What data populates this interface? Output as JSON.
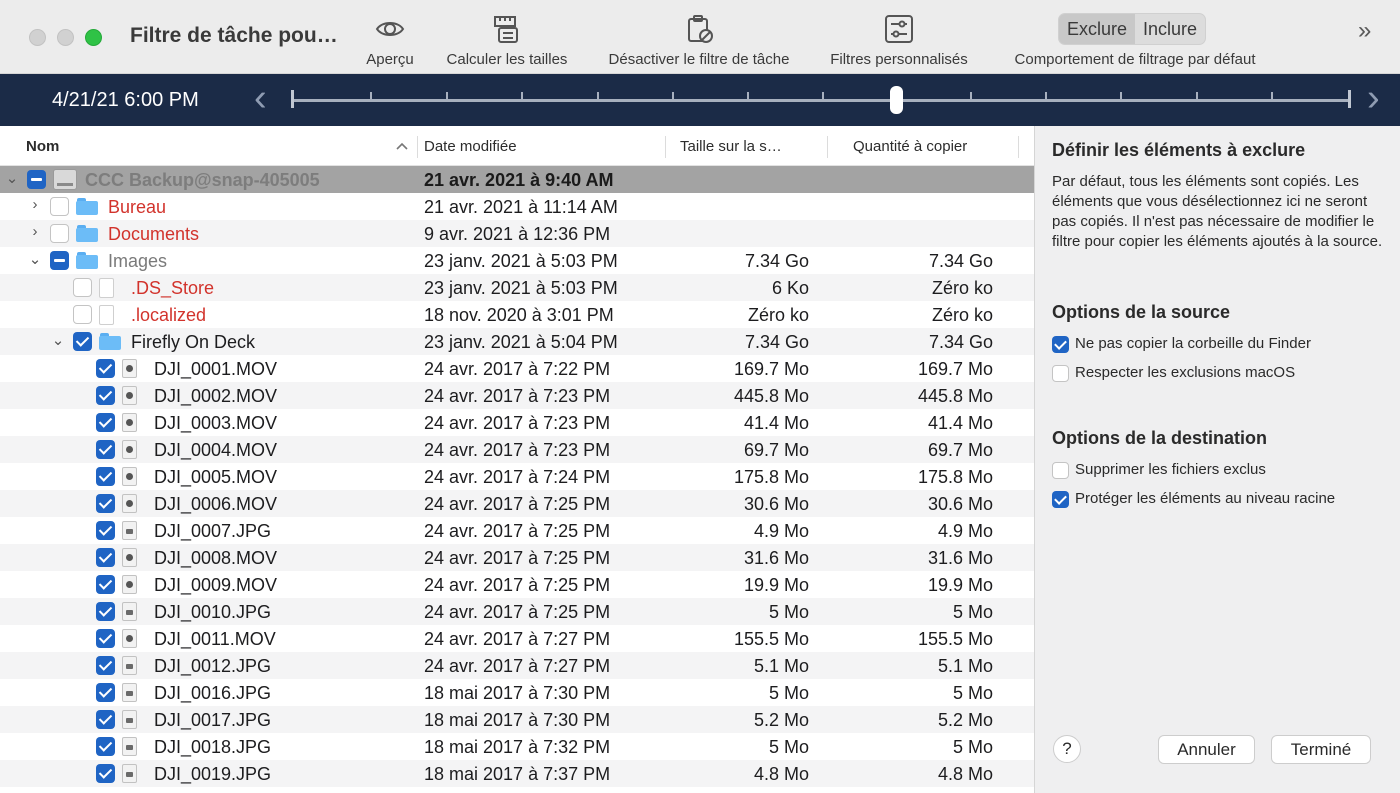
{
  "window": {
    "title": "Filtre de tâche pou…"
  },
  "toolbar": {
    "items": [
      {
        "label": "Aperçu",
        "icon": "eye-icon"
      },
      {
        "label": "Calculer les tailles",
        "icon": "ruler-calculator-icon"
      },
      {
        "label": "Désactiver le filtre de tâche",
        "icon": "clipboard-disable-icon"
      },
      {
        "label": "Filtres personnalisés",
        "icon": "sliders-icon"
      }
    ],
    "segment": {
      "exclude": "Exclure",
      "include": "Inclure",
      "selected": "exclude"
    },
    "segment_label": "Comportement de filtrage par défaut",
    "more": "»"
  },
  "timeline": {
    "date": "4/21/21 6:00 PM",
    "prev": "‹",
    "next": "›"
  },
  "table": {
    "columns": {
      "name": "Nom",
      "sort_indicator": "^",
      "date": "Date modifiée",
      "size": "Taille sur la s…",
      "copy": "Quantité à copier"
    },
    "rows": [
      {
        "name": "CCC Backup@snap-405005",
        "date": "21 avr. 2021 à 9:40 AM",
        "size": "",
        "copy": "",
        "check": "mixed",
        "kind": "drive",
        "disclosure": "⌄",
        "style": "selected"
      },
      {
        "name": "Bureau",
        "date": "21 avr. 2021 à 11:14 AM",
        "size": "",
        "copy": "",
        "check": "empty",
        "kind": "folder",
        "disclosure": "›",
        "style": "red"
      },
      {
        "name": "Documents",
        "date": "9 avr. 2021 à 12:36 PM",
        "size": "",
        "copy": "",
        "check": "empty",
        "kind": "folder",
        "disclosure": "›",
        "style": "red"
      },
      {
        "name": "Images",
        "date": "23 janv. 2021 à 5:03 PM",
        "size": "7.34 Go",
        "copy": "7.34 Go",
        "check": "mixed",
        "kind": "folder",
        "disclosure": "⌄",
        "style": "gray"
      },
      {
        "name": ".DS_Store",
        "date": "23 janv. 2021 à 5:03 PM",
        "size": "6 Ko",
        "copy": "Zéro ko",
        "check": "empty",
        "kind": "doc",
        "disclosure": "",
        "style": "red"
      },
      {
        "name": ".localized",
        "date": "18 nov. 2020 à 3:01 PM",
        "size": "Zéro ko",
        "copy": "Zéro ko",
        "check": "empty",
        "kind": "doc",
        "disclosure": "",
        "style": "red"
      },
      {
        "name": "Firefly On Deck",
        "date": "23 janv. 2021 à 5:04 PM",
        "size": "7.34 Go",
        "copy": "7.34 Go",
        "check": "checked",
        "kind": "folder",
        "disclosure": "⌄",
        "style": "normal"
      },
      {
        "name": "DJI_0001.MOV",
        "date": "24 avr. 2017 à 7:22 PM",
        "size": "169.7 Mo",
        "copy": "169.7 Mo",
        "check": "checked",
        "kind": "mov",
        "disclosure": "",
        "style": "normal"
      },
      {
        "name": "DJI_0002.MOV",
        "date": "24 avr. 2017 à 7:23 PM",
        "size": "445.8 Mo",
        "copy": "445.8 Mo",
        "check": "checked",
        "kind": "mov",
        "disclosure": "",
        "style": "normal"
      },
      {
        "name": "DJI_0003.MOV",
        "date": "24 avr. 2017 à 7:23 PM",
        "size": "41.4 Mo",
        "copy": "41.4 Mo",
        "check": "checked",
        "kind": "mov",
        "disclosure": "",
        "style": "normal"
      },
      {
        "name": "DJI_0004.MOV",
        "date": "24 avr. 2017 à 7:23 PM",
        "size": "69.7 Mo",
        "copy": "69.7 Mo",
        "check": "checked",
        "kind": "mov",
        "disclosure": "",
        "style": "normal"
      },
      {
        "name": "DJI_0005.MOV",
        "date": "24 avr. 2017 à 7:24 PM",
        "size": "175.8 Mo",
        "copy": "175.8 Mo",
        "check": "checked",
        "kind": "mov",
        "disclosure": "",
        "style": "normal"
      },
      {
        "name": "DJI_0006.MOV",
        "date": "24 avr. 2017 à 7:25 PM",
        "size": "30.6 Mo",
        "copy": "30.6 Mo",
        "check": "checked",
        "kind": "mov",
        "disclosure": "",
        "style": "normal"
      },
      {
        "name": "DJI_0007.JPG",
        "date": "24 avr. 2017 à 7:25 PM",
        "size": "4.9 Mo",
        "copy": "4.9 Mo",
        "check": "checked",
        "kind": "jpg",
        "disclosure": "",
        "style": "normal"
      },
      {
        "name": "DJI_0008.MOV",
        "date": "24 avr. 2017 à 7:25 PM",
        "size": "31.6 Mo",
        "copy": "31.6 Mo",
        "check": "checked",
        "kind": "mov",
        "disclosure": "",
        "style": "normal"
      },
      {
        "name": "DJI_0009.MOV",
        "date": "24 avr. 2017 à 7:25 PM",
        "size": "19.9 Mo",
        "copy": "19.9 Mo",
        "check": "checked",
        "kind": "mov",
        "disclosure": "",
        "style": "normal"
      },
      {
        "name": "DJI_0010.JPG",
        "date": "24 avr. 2017 à 7:25 PM",
        "size": "5 Mo",
        "copy": "5 Mo",
        "check": "checked",
        "kind": "jpg",
        "disclosure": "",
        "style": "normal"
      },
      {
        "name": "DJI_0011.MOV",
        "date": "24 avr. 2017 à 7:27 PM",
        "size": "155.5 Mo",
        "copy": "155.5 Mo",
        "check": "checked",
        "kind": "mov",
        "disclosure": "",
        "style": "normal"
      },
      {
        "name": "DJI_0012.JPG",
        "date": "24 avr. 2017 à 7:27 PM",
        "size": "5.1 Mo",
        "copy": "5.1 Mo",
        "check": "checked",
        "kind": "jpg",
        "disclosure": "",
        "style": "normal"
      },
      {
        "name": "DJI_0016.JPG",
        "date": "18 mai 2017 à 7:30 PM",
        "size": "5 Mo",
        "copy": "5 Mo",
        "check": "checked",
        "kind": "jpg",
        "disclosure": "",
        "style": "normal"
      },
      {
        "name": "DJI_0017.JPG",
        "date": "18 mai 2017 à 7:30 PM",
        "size": "5.2 Mo",
        "copy": "5.2 Mo",
        "check": "checked",
        "kind": "jpg",
        "disclosure": "",
        "style": "normal"
      },
      {
        "name": "DJI_0018.JPG",
        "date": "18 mai 2017 à 7:32 PM",
        "size": "5 Mo",
        "copy": "5 Mo",
        "check": "checked",
        "kind": "jpg",
        "disclosure": "",
        "style": "normal"
      },
      {
        "name": "DJI_0019.JPG",
        "date": "18 mai 2017 à 7:37 PM",
        "size": "4.8 Mo",
        "copy": "4.8 Mo",
        "check": "checked",
        "kind": "jpg",
        "disclosure": "",
        "style": "normal"
      }
    ]
  },
  "panel": {
    "define_title": "Définir les éléments à exclure",
    "define_text": "Par défaut, tous les éléments sont copiés. Les éléments que vous désélectionnez ici ne seront pas copiés. Il n'est pas nécessaire de modifier le filtre pour copier les éléments ajoutés à la source.",
    "source_title": "Options de la source",
    "source_options": [
      {
        "label": "Ne pas copier la corbeille du Finder",
        "checked": true
      },
      {
        "label": "Respecter les exclusions macOS",
        "checked": false
      }
    ],
    "dest_title": "Options de la destination",
    "dest_options": [
      {
        "label": "Supprimer les fichiers exclus",
        "checked": false
      },
      {
        "label": "Protéger les éléments au niveau racine",
        "checked": true
      }
    ],
    "help": "?",
    "cancel": "Annuler",
    "done": "Terminé"
  },
  "colors": {
    "accent": "#1f64c4",
    "timeline_bg": "#1b2b47",
    "excluded_text": "#d2332c",
    "selected_row": "#a3a3a3"
  }
}
